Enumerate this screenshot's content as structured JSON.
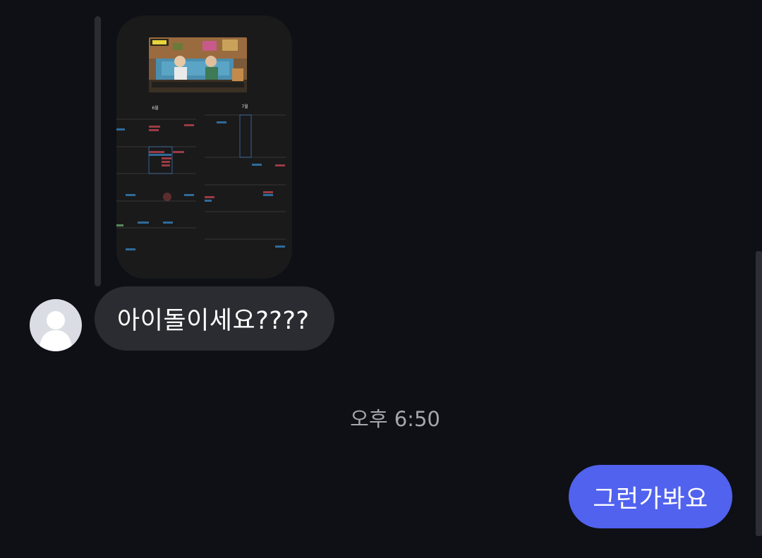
{
  "thread": {
    "shared_image": {
      "calendar": {
        "month_left": "6월",
        "month_right": "7월"
      }
    },
    "incoming_message": "아이돌이세요????",
    "timestamp": "오후 6:50",
    "outgoing_message": "그런가봐요"
  },
  "colors": {
    "background": "#0e1015",
    "incoming_bubble": "#2a2c31",
    "outgoing_bubble": "#5162ee",
    "timestamp_text": "#a4a7ad"
  },
  "icons": {
    "avatar": "default-profile-icon"
  }
}
